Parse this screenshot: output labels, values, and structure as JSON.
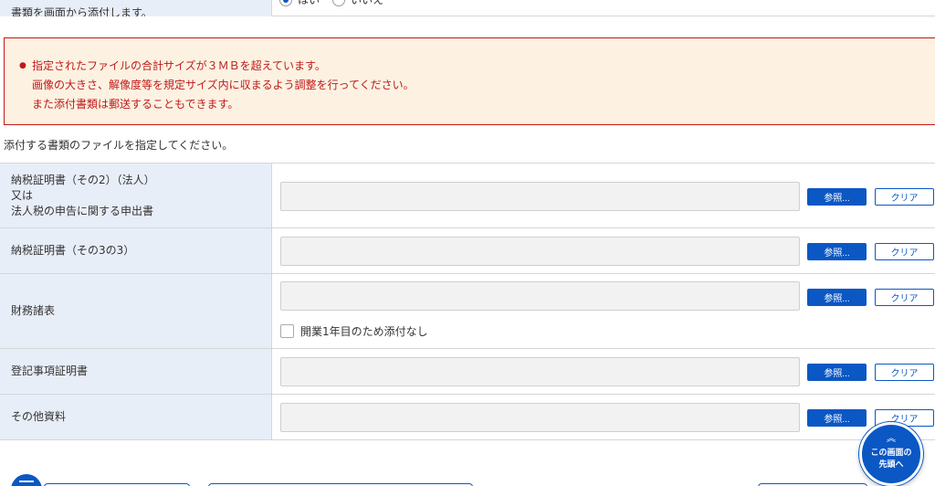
{
  "top_row": {
    "label": "書類を画面から添付します。",
    "options": [
      "はい",
      "いいえ"
    ],
    "selected": "はい"
  },
  "error": {
    "lines": [
      "指定されたファイルの合計サイズが３ＭＢを超えています。",
      "画像の大きさ、解像度等を規定サイズ内に収まるよう調整を行ってください。",
      "また添付書類は郵送することもできます。"
    ],
    "color": "#c01919",
    "background": "#fdf2e2"
  },
  "instruction": "添付する書類のファイルを指定してください。",
  "buttons": {
    "browse": "参照...",
    "clear": "クリア"
  },
  "rows": [
    {
      "label_lines": [
        "納税証明書（その2）（法人）",
        "又は",
        "法人税の申告に関する申出書"
      ]
    },
    {
      "label_lines": [
        "納税証明書（その3の3）"
      ]
    },
    {
      "label_lines": [
        "財務諸表"
      ],
      "checkbox": "開業1年目のため添付なし"
    },
    {
      "label_lines": [
        "登記事項証明書"
      ]
    },
    {
      "label_lines": [
        "その他資料"
      ]
    }
  ],
  "scroll_top": {
    "lines": [
      "この画面の",
      "先頭へ"
    ]
  },
  "colors": {
    "accent": "#0b57c4",
    "label_bg": "#e8eef8",
    "field_bg": "#f2f2f2"
  }
}
